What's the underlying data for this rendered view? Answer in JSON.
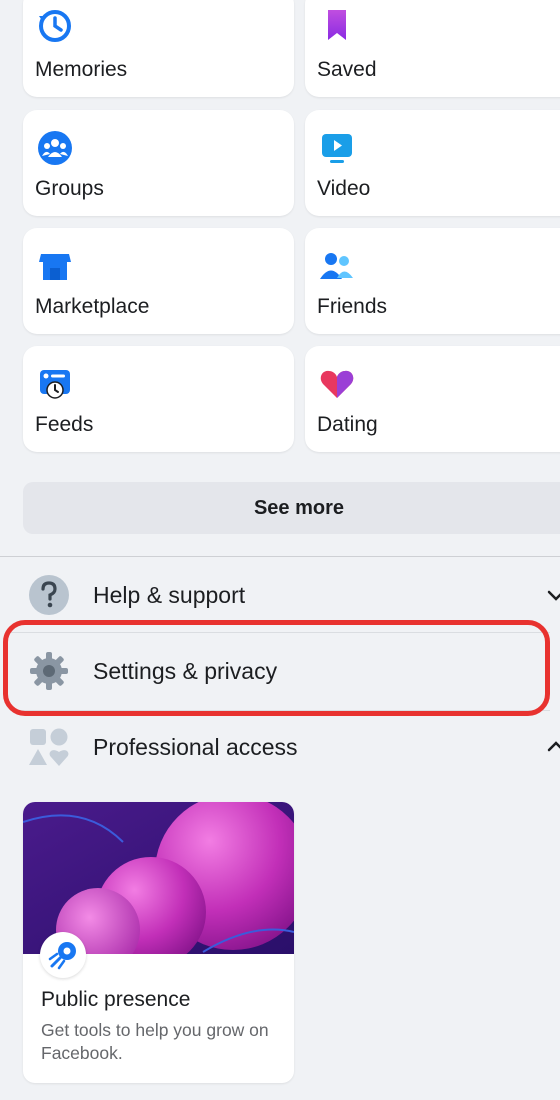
{
  "shortcuts": [
    {
      "label": "Memories",
      "icon": "clock-history-icon"
    },
    {
      "label": "Saved",
      "icon": "bookmark-icon"
    },
    {
      "label": "Groups",
      "icon": "groups-icon"
    },
    {
      "label": "Video",
      "icon": "video-icon"
    },
    {
      "label": "Marketplace",
      "icon": "marketplace-icon"
    },
    {
      "label": "Friends",
      "icon": "friends-icon"
    },
    {
      "label": "Feeds",
      "icon": "feeds-icon"
    },
    {
      "label": "Dating",
      "icon": "dating-heart-icon"
    }
  ],
  "see_more_label": "See more",
  "menu": {
    "help": {
      "label": "Help & support",
      "icon": "question-icon",
      "expanded": false
    },
    "settings": {
      "label": "Settings & privacy",
      "icon": "gear-icon",
      "highlighted": true
    },
    "professional": {
      "label": "Professional access",
      "icon": "shapes-icon",
      "expanded": true
    }
  },
  "card": {
    "title": "Public presence",
    "description": "Get tools to help you grow on Facebook.",
    "icon": "rocket-icon"
  },
  "colors": {
    "background": "#f0f2f5",
    "tile": "#ffffff",
    "highlight": "#e8322f",
    "accent_blue": "#1877f2"
  }
}
